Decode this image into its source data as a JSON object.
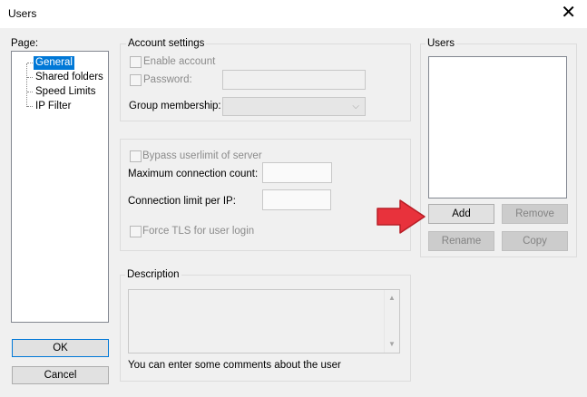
{
  "window": {
    "title": "Users",
    "close_glyph": "✕"
  },
  "page_panel": {
    "label": "Page:",
    "items": [
      "General",
      "Shared folders",
      "Speed Limits",
      "IP Filter"
    ],
    "selected": "General"
  },
  "account_settings": {
    "title": "Account settings",
    "enable_account": "Enable account",
    "password_label": "Password:",
    "password_value": "",
    "group_label": "Group membership:",
    "group_value": ""
  },
  "limits": {
    "bypass": "Bypass userlimit of server",
    "max_conn_label": "Maximum connection count:",
    "max_conn_value": "",
    "limit_per_ip_label": "Connection limit per IP:",
    "limit_per_ip_value": "",
    "force_tls": "Force TLS for user login"
  },
  "description": {
    "title": "Description",
    "text": "",
    "hint": "You can enter some comments about the user"
  },
  "users": {
    "title": "Users",
    "list": [],
    "add": "Add",
    "remove": "Remove",
    "rename": "Rename",
    "copy": "Copy"
  },
  "buttons": {
    "ok": "OK",
    "cancel": "Cancel"
  },
  "annotation": {
    "arrow_color": "#e8323c",
    "arrow_icon": "red-arrow-icon"
  }
}
